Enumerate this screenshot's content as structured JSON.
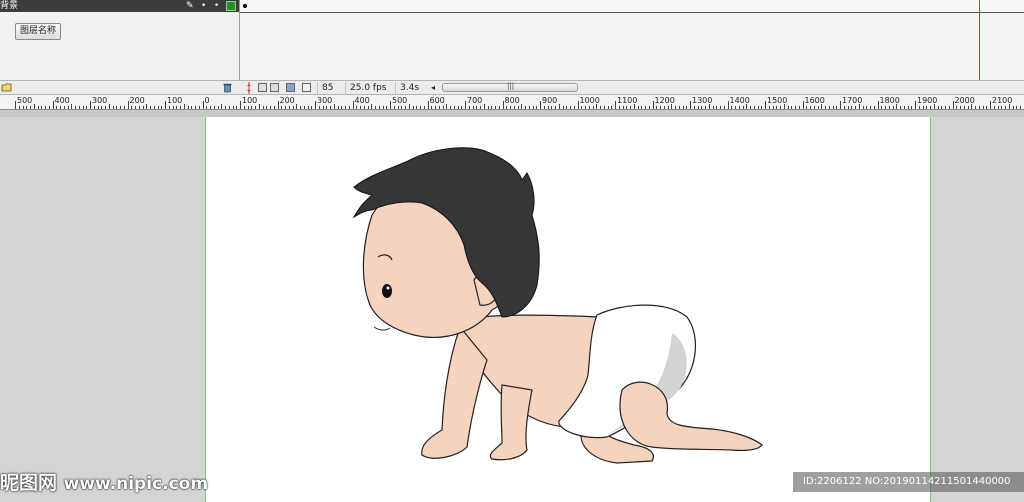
{
  "timeline": {
    "layer_name": "背景",
    "layer_name_button": "图层名称",
    "icons": {
      "edit": "pencil-icon",
      "new_layer": "new-layer-icon",
      "delete": "trash-icon"
    },
    "current_frame": "85",
    "frame_rate": "25.0 fps",
    "elapsed_time": "3.4s"
  },
  "ruler": {
    "labels": [
      "500",
      "400",
      "300",
      "200",
      "100",
      "0",
      "100",
      "200",
      "300",
      "400",
      "500",
      "600",
      "700",
      "800",
      "900",
      "1000",
      "1100",
      "1200",
      "1300",
      "1400",
      "1500",
      "1600",
      "1700",
      "1800",
      "1900",
      "2000",
      "2100"
    ]
  },
  "watermark": {
    "site_cn": "昵图网",
    "site_url": "www.nipic.com",
    "id_text": "ID:2206122 NO:20190114211501440000"
  },
  "colors": {
    "hair": "#363636",
    "skin": "#f5d3bf",
    "diaper": "#ffffff",
    "diaper_shadow": "#d3d3d3",
    "playhead": "#c0392b",
    "stage_border": "#7ecf7e"
  }
}
